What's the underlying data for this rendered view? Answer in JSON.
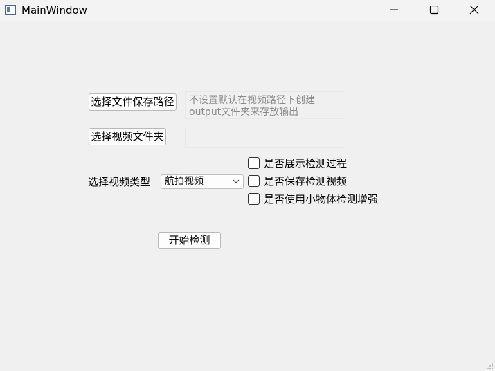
{
  "window": {
    "title": "MainWindow",
    "icon": "app-window-icon",
    "controls": {
      "minimize_icon": "minimize-icon",
      "maximize_icon": "maximize-icon",
      "close_icon": "close-icon"
    }
  },
  "form": {
    "save_path_button": "选择文件保存路径",
    "save_path_hint": "不设置默认在视频路径下创建\noutput文件夹来存放输出",
    "video_folder_button": "选择视频文件夹",
    "video_folder_value": "",
    "video_type_label": "选择视频类型",
    "video_type_selected": "航拍视频",
    "checkboxes": [
      {
        "label": "是否展示检测过程",
        "checked": false
      },
      {
        "label": "是否保存检测视频",
        "checked": false
      },
      {
        "label": "是否使用小物体检测增强",
        "checked": false
      }
    ],
    "start_button": "开始检测"
  },
  "colors": {
    "window_bg": "#f0f0f0",
    "titlebar_bg": "#f3f3f3",
    "hint_text": "#8a8a8a"
  }
}
